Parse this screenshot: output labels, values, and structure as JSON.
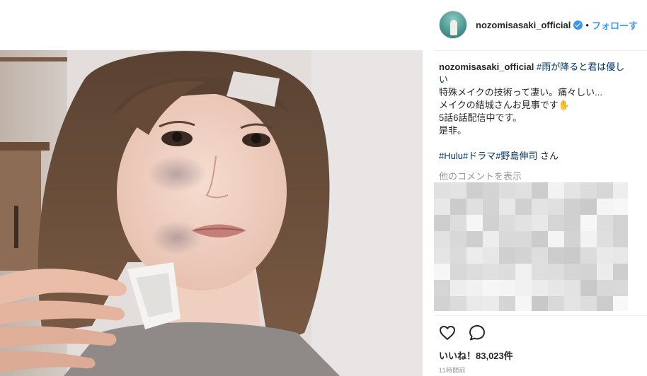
{
  "post": {
    "username": "nozomisasaki_official",
    "header_separator": "•",
    "follow_label": "フォローす",
    "caption": {
      "username": "nozomisasaki_official",
      "hashtag_1": "#雨が降ると君は優しい",
      "line_1": "特殊メイクの技術って凄い。痛々しい...",
      "line_2": "メイクの結城さんお見事です✋",
      "line_3": "5話6話配信中です。",
      "line_4": "是非。",
      "tag_hulu": "#Hulu",
      "tag_drama": "#ドラマ",
      "tag_nojima": "#野島伸司",
      "suffix": " さん"
    },
    "more_comments_label": "他のコメントを表示",
    "likes_text": "いいね！83,023件",
    "time_ago": "11時間前"
  },
  "icons": {
    "verified": "verified-badge-icon",
    "like": "heart-outline-icon",
    "comment": "comment-bubble-icon"
  },
  "colors": {
    "link_blue": "#3897f0",
    "hashtag": "#003569",
    "muted": "#999999",
    "text": "#262626"
  }
}
